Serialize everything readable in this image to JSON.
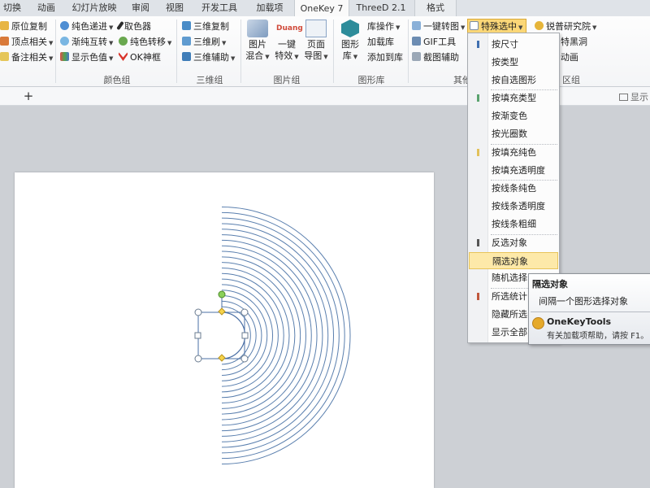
{
  "tabs": [
    {
      "label": "切换",
      "active": false
    },
    {
      "label": "动画",
      "active": false
    },
    {
      "label": "幻灯片放映",
      "active": false
    },
    {
      "label": "审阅",
      "active": false
    },
    {
      "label": "视图",
      "active": false
    },
    {
      "label": "开发工具",
      "active": false
    },
    {
      "label": "加载项",
      "active": false
    },
    {
      "label": "OneKey 7",
      "active": true
    },
    {
      "label": "ThreeD 2.1",
      "active": false
    },
    {
      "label": "格式",
      "active": false
    }
  ],
  "ribbon": {
    "col1": [
      "原位复制",
      "顶点相关",
      "备注相关"
    ],
    "color_group": {
      "items": [
        "纯色递进",
        "取色器",
        "渐纯互转",
        "纯色转移",
        "显示色值",
        "OK神框"
      ],
      "label": "颜色组"
    },
    "threed_group": {
      "items": [
        "三维复制",
        "三维刷",
        "三维辅助"
      ],
      "label": "三维组"
    },
    "image_group": {
      "buttons": [
        {
          "line1": "图片",
          "line2": "混合"
        },
        {
          "line1": "一键",
          "line2": "特效",
          "badge": "Duang"
        },
        {
          "line1": "页面",
          "line2": "导图"
        }
      ],
      "label": "图片组"
    },
    "shape_lib": {
      "big_line1": "图形",
      "big_line2": "库",
      "items": [
        "库操作",
        "加载库",
        "添加到库"
      ],
      "label": "图形库"
    },
    "other_group": {
      "items": [
        "一键转图",
        "GIF工具",
        "截图辅助"
      ],
      "label": "其他"
    },
    "special_select": "特殊选中",
    "right_group": {
      "items": [
        "锐普研究院",
        "特黑洞",
        "动画"
      ],
      "label": "区组"
    }
  },
  "strip": {
    "plus": "+",
    "show_label": "显示"
  },
  "menu": {
    "items": [
      {
        "label": "按尺寸",
        "marker": "#3f6fb0"
      },
      {
        "label": "按类型",
        "marker": ""
      },
      {
        "label": "按自选图形",
        "marker": ""
      },
      {
        "label": "按填充类型",
        "marker": "#5aa36e",
        "sep_before": true
      },
      {
        "label": "按渐变色",
        "marker": ""
      },
      {
        "label": "按光圈数",
        "marker": ""
      },
      {
        "label": "按填充纯色",
        "marker": "#e2c15a",
        "sep_before": true
      },
      {
        "label": "按填充透明度",
        "marker": ""
      },
      {
        "label": "按线条纯色",
        "marker": "",
        "sep_before": true
      },
      {
        "label": "按线条透明度",
        "marker": ""
      },
      {
        "label": "按线条粗细",
        "marker": ""
      },
      {
        "label": "反选对象",
        "marker": "#555555",
        "sep_before": true
      },
      {
        "label": "隔选对象",
        "marker": "",
        "highlighted": true
      },
      {
        "label": "随机选择",
        "marker": ""
      },
      {
        "label": "所选统计",
        "marker": "#c0573c",
        "sep_before": true
      },
      {
        "label": "隐藏所选",
        "marker": ""
      },
      {
        "label": "显示全部",
        "marker": ""
      }
    ]
  },
  "tooltip": {
    "title": "隔选对象",
    "desc": "间隔一个图形选择对象",
    "addin": "OneKeyTools",
    "help": "有关加载项帮助，请按 F1。"
  },
  "slide": {
    "ring_color": "#5a7fae",
    "arc_count": 20
  }
}
